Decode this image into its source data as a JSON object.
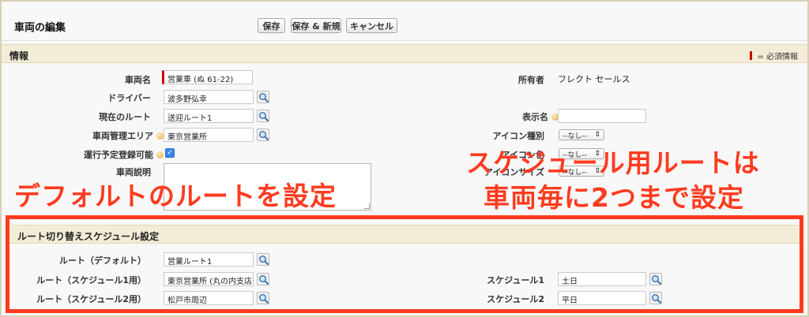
{
  "page": {
    "title": "車両の編集"
  },
  "toolbar": {
    "save": "保存",
    "save_new": "保存 & 新規",
    "cancel": "キャンセル"
  },
  "section_info": {
    "title": "情報",
    "required_legend": "= 必須情報"
  },
  "fields": {
    "vehicle_name": {
      "label": "車両名",
      "value": "営業車 (ぬ 61-22)"
    },
    "driver": {
      "label": "ドライバー",
      "value": "波多野弘幸"
    },
    "current_route": {
      "label": "現在のルート",
      "value": "送迎ルート1"
    },
    "area": {
      "label": "車両管理エリア",
      "value": "東京営業所"
    },
    "schedulable": {
      "label": "運行予定登録可能",
      "checked": true
    },
    "description": {
      "label": "車両説明",
      "value": ""
    },
    "owner": {
      "label": "所有者",
      "value": "フレクト セールス"
    },
    "display_name": {
      "label": "表示名",
      "value": ""
    },
    "icon_type": {
      "label": "アイコン種別",
      "value": "--なし--"
    },
    "icon_color": {
      "label": "アイコン色",
      "value": "--なし--"
    },
    "icon_size": {
      "label": "アイコンサイズ",
      "value": "--なし--"
    }
  },
  "section_schedule": {
    "title": "ルート切り替えスケジュール設定",
    "route_default": {
      "label": "ルート（デフォルト）",
      "value": "営業ルート1"
    },
    "route_schedule1": {
      "label": "ルート（スケジュール1用）",
      "value": "東京営業所 (丸の内支店)"
    },
    "route_schedule2": {
      "label": "ルート（スケジュール2用）",
      "value": "松戸市周辺"
    },
    "schedule1": {
      "label": "スケジュール1",
      "value": "土日"
    },
    "schedule2": {
      "label": "スケジュール2",
      "value": "平日"
    }
  },
  "annotations": {
    "default_route": "デフォルトのルートを設定",
    "schedule_route_line1": "スケジュール用ルートは",
    "schedule_route_line2": "車両毎に2つまで設定"
  },
  "colors": {
    "annotation": "#ff3b1f",
    "required": "#cc0000",
    "section_bg": "#f3ecd6"
  }
}
